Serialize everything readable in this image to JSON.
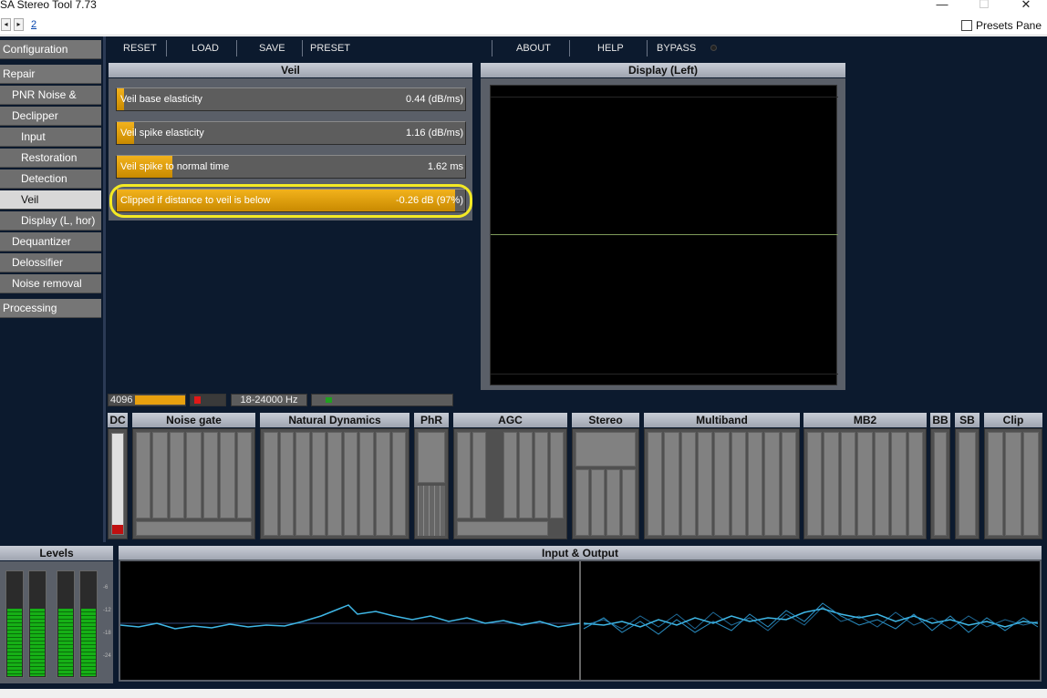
{
  "window": {
    "title": "SA Stereo Tool 7.73",
    "controls": [
      "—",
      "☐",
      "✕"
    ]
  },
  "toolbar_row": {
    "back": "◂",
    "forward": "▸",
    "page": "2",
    "presets_pane": "Presets Pane"
  },
  "sidebar": {
    "items": [
      {
        "label": "Configuration",
        "level": 1,
        "selected": false
      },
      {
        "label": "Repair",
        "level": 1,
        "selected": false
      },
      {
        "label": "PNR Noise & Hum",
        "level": 2,
        "selected": false
      },
      {
        "label": "Declipper",
        "level": 2,
        "selected": false
      },
      {
        "label": "Input",
        "level": 3,
        "selected": false
      },
      {
        "label": "Restoration",
        "level": 3,
        "selected": false
      },
      {
        "label": "Detection",
        "level": 3,
        "selected": false
      },
      {
        "label": "Veil",
        "level": 3,
        "selected": true
      },
      {
        "label": "Display (L, hor)",
        "level": 3,
        "selected": false
      },
      {
        "label": "Dequantizer",
        "level": 2,
        "selected": false
      },
      {
        "label": "Delossifier",
        "level": 2,
        "selected": false
      },
      {
        "label": "Noise removal",
        "level": 2,
        "selected": false
      },
      {
        "label": "Processing",
        "level": 1,
        "selected": false
      }
    ]
  },
  "top_buttons": {
    "reset": "RESET",
    "load": "LOAD",
    "save": "SAVE",
    "preset": "PRESET",
    "about": "ABOUT",
    "help": "HELP",
    "bypass": "BYPASS"
  },
  "veil_panel": {
    "title": "Veil",
    "sliders": [
      {
        "label": "Veil base elasticity",
        "value": "0.44 (dB/ms)",
        "level": 0.02
      },
      {
        "label": "Veil spike elasticity",
        "value": "1.16 (dB/ms)",
        "level": 0.05
      },
      {
        "label": "Veil spike to normal time",
        "value": "1.62 ms",
        "level": 0.16
      },
      {
        "label": "Clipped if distance to veil is below",
        "value": "-0.26 dB (97%)",
        "level": 0.97
      }
    ]
  },
  "display_panel": {
    "title": "Display (Left)"
  },
  "status_strip": {
    "buffer": "4096",
    "freq_range": "18-24000 Hz"
  },
  "modules": [
    {
      "label": "DC"
    },
    {
      "label": "Noise gate"
    },
    {
      "label": "Natural Dynamics"
    },
    {
      "label": "PhR"
    },
    {
      "label": "AGC"
    },
    {
      "label": "Stereo"
    },
    {
      "label": "Multiband"
    },
    {
      "label": "MB2"
    },
    {
      "label": "BB"
    },
    {
      "label": "SB"
    },
    {
      "label": "Clip"
    }
  ],
  "levels": {
    "title": "Levels",
    "scale": [
      "-6",
      "-12",
      "-18",
      "-24"
    ]
  },
  "io": {
    "title": "Input & Output"
  },
  "colors": {
    "accent": "#e8a00e",
    "highlight": "#f3e924",
    "background": "#0c1a2e",
    "waveform": "#3fb7e6"
  }
}
